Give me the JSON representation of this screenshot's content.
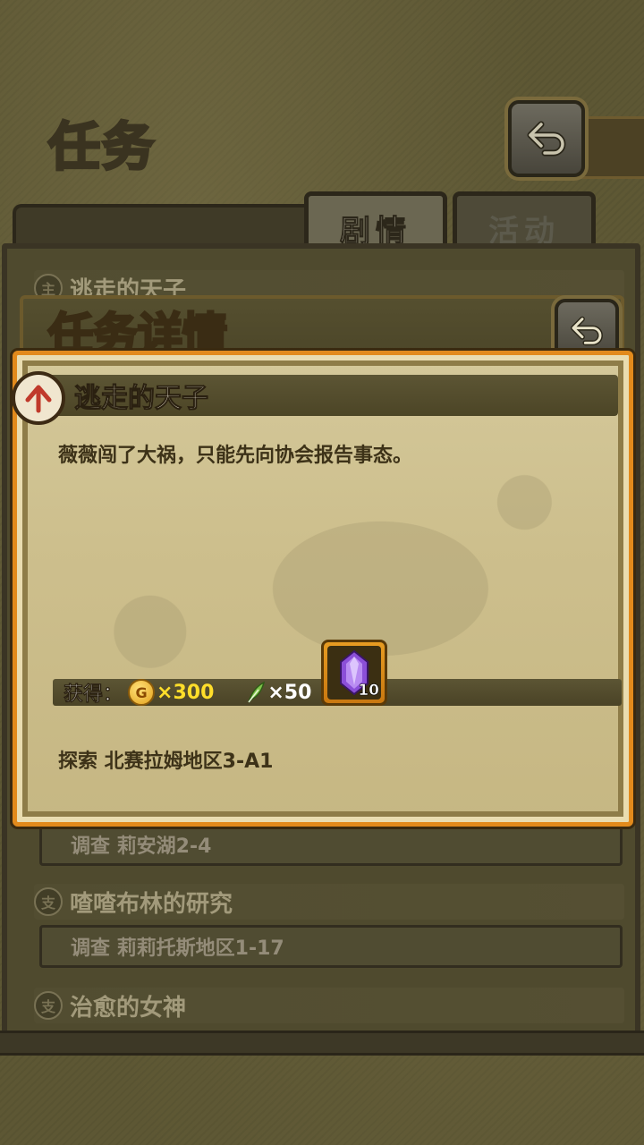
{
  "screen": {
    "title": "任务",
    "tabs": [
      {
        "label": "剧情",
        "active": true
      },
      {
        "label": "活动",
        "active": false
      }
    ]
  },
  "quest_list": {
    "items": [
      {
        "tag": "主",
        "title": "逃走的天子"
      },
      {
        "objective": "调查 莉安湖2-4"
      },
      {
        "tag": "支",
        "title": "喳喳布林的研究"
      },
      {
        "objective": "调查 莉莉托斯地区1-17"
      },
      {
        "tag": "支",
        "title": "治愈的女神"
      }
    ]
  },
  "detail": {
    "header": "任务详情",
    "quest_title": "逃走的天子",
    "description": "薇薇闯了大祸，只能先向协会报告事态。",
    "rewards": {
      "label": "获得：",
      "coin_icon_letter": "G",
      "coin_amount": "×300",
      "feather_amount": "×50",
      "gem_count": "10"
    },
    "objective": "探索 北赛拉姆地区3-A1"
  },
  "colors": {
    "accent_orange": "#e28a1c",
    "coin_text": "#ffde2a",
    "parchment": "#cdbf8d"
  },
  "icons": [
    "back-arrow-icon",
    "quest-badge-icon",
    "coin-icon",
    "feather-icon",
    "purple-gem-icon"
  ]
}
